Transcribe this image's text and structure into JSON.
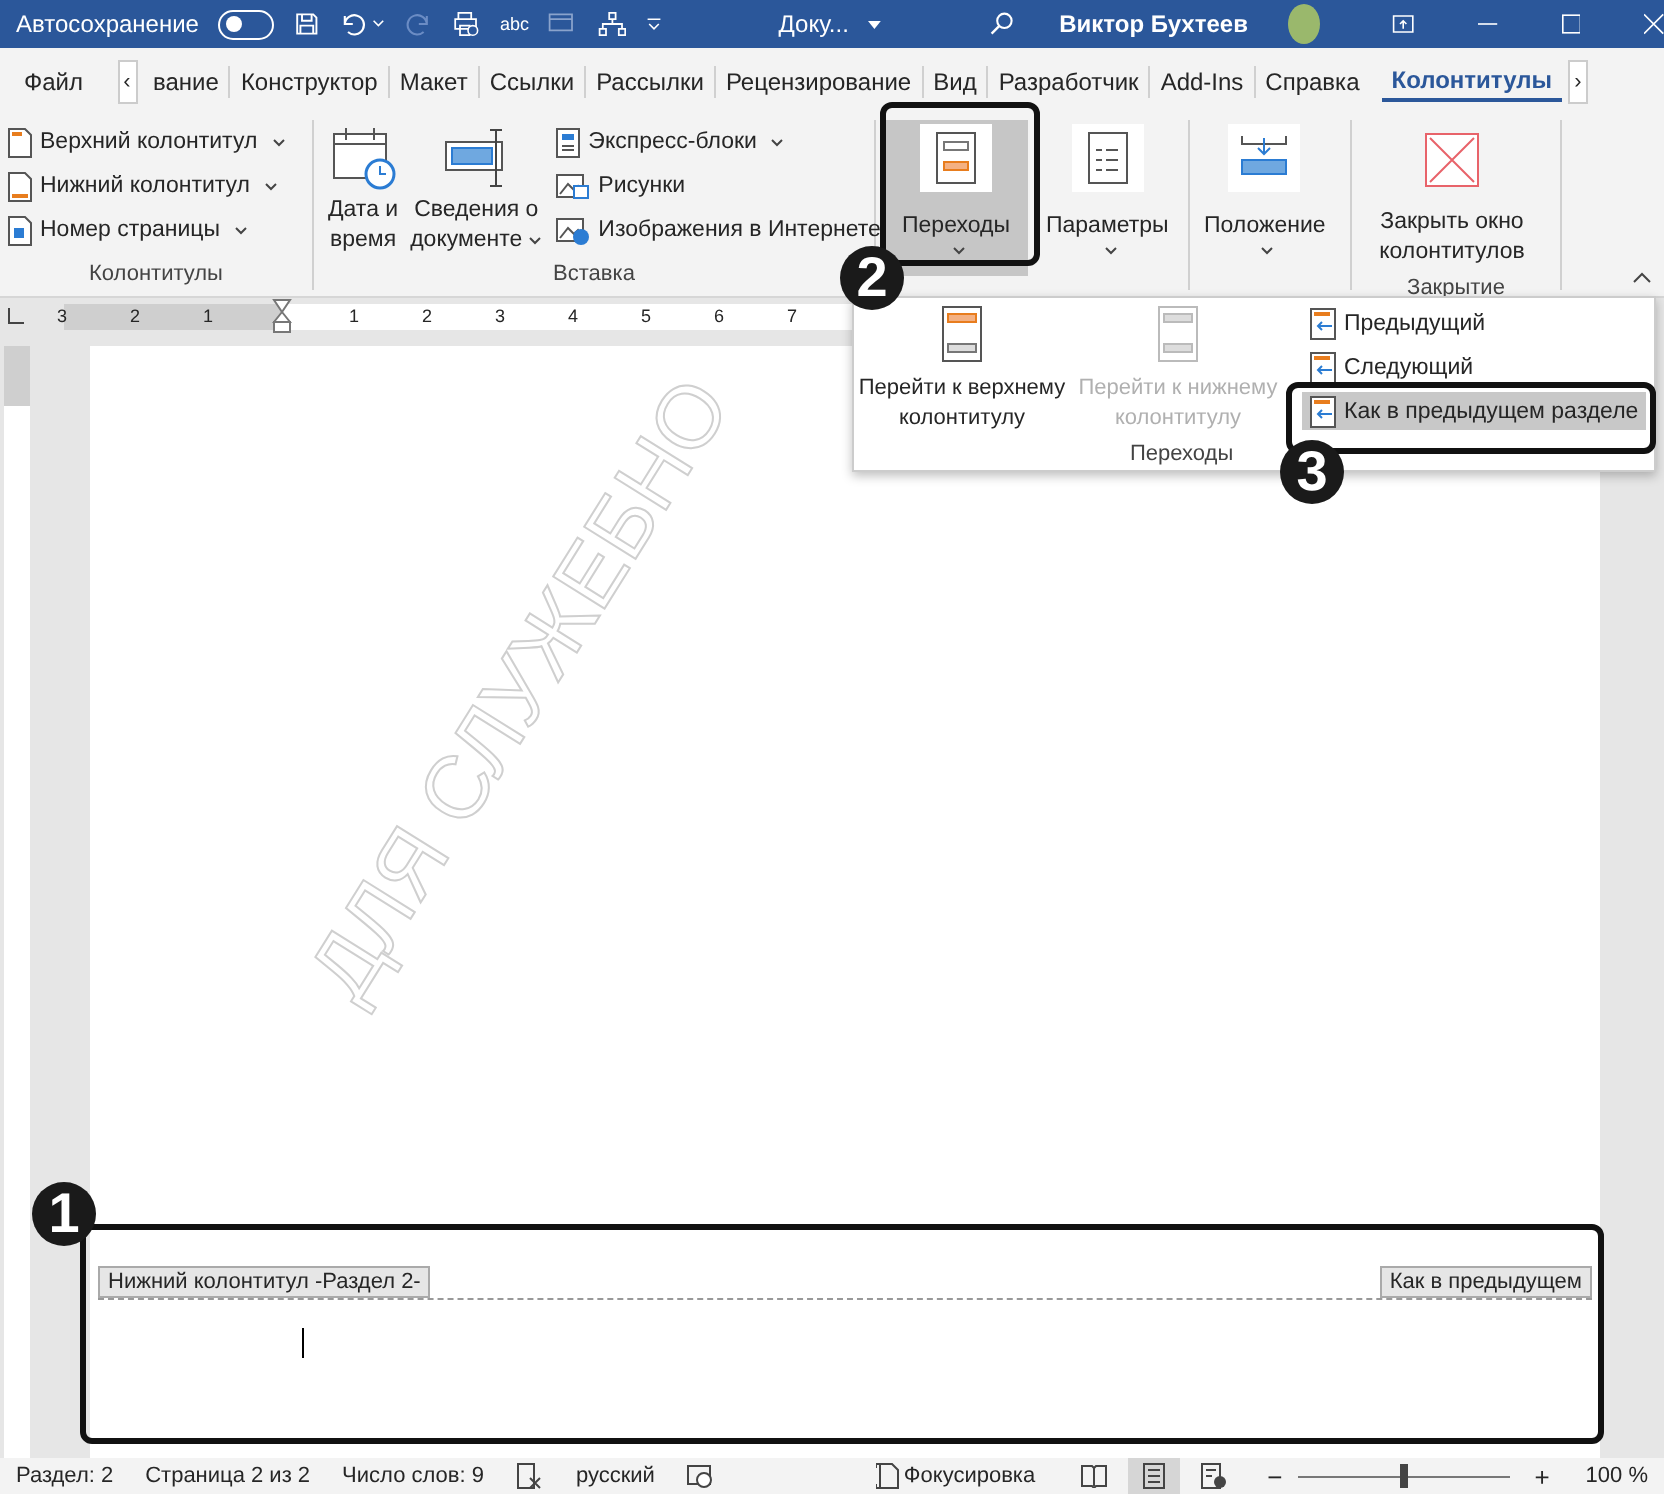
{
  "title_bar": {
    "autosave_label": "Автосохранение",
    "autosave_on": false,
    "spelling_icon_text": "abc",
    "document": "Доку...",
    "user": "Виктор Бухтеев"
  },
  "tabs": [
    {
      "label": "Файл",
      "selected": false
    },
    {
      "label": "‹",
      "kind": "scroll"
    },
    {
      "label": "вание",
      "selected": false
    },
    {
      "label": "Конструктор",
      "selected": false
    },
    {
      "label": "Макет",
      "selected": false
    },
    {
      "label": "Ссылки",
      "selected": false
    },
    {
      "label": "Рассылки",
      "selected": false
    },
    {
      "label": "Рецензирование",
      "selected": false
    },
    {
      "label": "Вид",
      "selected": false
    },
    {
      "label": "Разработчик",
      "selected": false
    },
    {
      "label": "Add-Ins",
      "selected": false
    },
    {
      "label": "Справка",
      "selected": false
    },
    {
      "label": "Колонтитулы",
      "selected": true
    },
    {
      "label": "›",
      "kind": "scroll"
    }
  ],
  "ribbon": {
    "header_footer": {
      "label": "Колонтитулы",
      "items": [
        {
          "label": "Верхний колонтитул",
          "caret": true
        },
        {
          "label": "Нижний колонтитул",
          "caret": true
        },
        {
          "label": "Номер страницы",
          "caret": true
        }
      ]
    },
    "insert": {
      "label": "Вставка",
      "large": [
        {
          "lines": [
            "Дата и",
            "время"
          ],
          "caret": false
        },
        {
          "lines": [
            "Сведения о",
            "документе"
          ],
          "caret": true
        }
      ],
      "items": [
        {
          "label": "Экспресс-блоки",
          "caret": true
        },
        {
          "label": "Рисунки",
          "caret": false
        },
        {
          "label": "Изображения в Интернете",
          "caret": false
        }
      ]
    },
    "navigation": {
      "large": [
        {
          "lines": [
            "Переходы"
          ],
          "caret": true,
          "pressed": true
        },
        {
          "lines": [
            "Параметры"
          ],
          "caret": true,
          "pressed": false
        }
      ]
    },
    "position": {
      "large": [
        {
          "lines": [
            "Положение"
          ],
          "caret": true,
          "pressed": false
        }
      ]
    },
    "close": {
      "label": "Закрытие",
      "large": [
        {
          "lines": [
            "Закрыть окно",
            "колонтитулов"
          ],
          "pressed": false
        }
      ]
    }
  },
  "ruler": {
    "labels": [
      "3",
      "2",
      "1",
      "1",
      "2",
      "3",
      "4",
      "5",
      "6",
      "7"
    ]
  },
  "document": {
    "watermark": "ДЛЯ СЛУЖЕБНО",
    "footer": {
      "label": "Нижний колонтитул -Раздел 2-",
      "link_label": "Как в предыдущем"
    }
  },
  "dropdown": {
    "large": [
      {
        "lines": [
          "Перейти к верхнему",
          "колонтитулу"
        ],
        "disabled": false
      },
      {
        "lines": [
          "Перейти к нижнему",
          "колонтитулу"
        ],
        "disabled": true
      }
    ],
    "items": [
      {
        "label": "Предыдущий",
        "selected": false
      },
      {
        "label": "Следующий",
        "selected": false
      },
      {
        "label": "Как в предыдущем разделе",
        "selected": true
      }
    ],
    "group_label": "Переходы"
  },
  "callouts": [
    {
      "number": "1"
    },
    {
      "number": "2"
    },
    {
      "number": "3"
    }
  ],
  "status_bar": {
    "section": "Раздел: 2",
    "page": "Страница 2 из 2",
    "words": "Число слов: 9",
    "language": "русский",
    "focus": "Фокусировка",
    "views": [
      {
        "selected": false
      },
      {
        "selected": true
      },
      {
        "selected": false
      }
    ],
    "zoom_out": "−",
    "zoom_in": "+",
    "zoom": {
      "level": 0.5
    },
    "zoom_label": "100 %"
  }
}
